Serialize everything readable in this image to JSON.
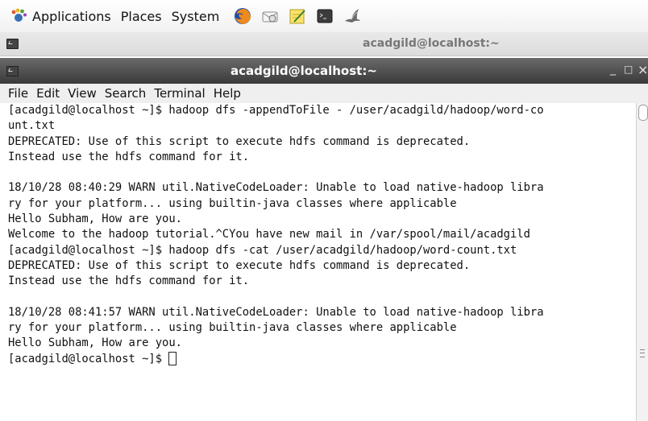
{
  "panel": {
    "menus": [
      "Applications",
      "Places",
      "System"
    ],
    "launchers": [
      "firefox-icon",
      "mail-icon",
      "notes-icon",
      "terminal-icon",
      "wireshark-icon"
    ]
  },
  "background_window": {
    "title": "acadgild@localhost:~"
  },
  "window": {
    "title": "acadgild@localhost:~",
    "controls": {
      "minimize": "_",
      "maximize": "□",
      "close": "×"
    },
    "menu": [
      "File",
      "Edit",
      "View",
      "Search",
      "Terminal",
      "Help"
    ]
  },
  "terminal": {
    "lines": [
      "[acadgild@localhost ~]$ hadoop dfs -appendToFile - /user/acadgild/hadoop/word-co",
      "unt.txt",
      "DEPRECATED: Use of this script to execute hdfs command is deprecated.",
      "Instead use the hdfs command for it.",
      "",
      "18/10/28 08:40:29 WARN util.NativeCodeLoader: Unable to load native-hadoop libra",
      "ry for your platform... using builtin-java classes where applicable",
      "Hello Subham, How are you.",
      "Welcome to the hadoop tutorial.^CYou have new mail in /var/spool/mail/acadgild",
      "[acadgild@localhost ~]$ hadoop dfs -cat /user/acadgild/hadoop/word-count.txt",
      "DEPRECATED: Use of this script to execute hdfs command is deprecated.",
      "Instead use the hdfs command for it.",
      "",
      "18/10/28 08:41:57 WARN util.NativeCodeLoader: Unable to load native-hadoop libra",
      "ry for your platform... using builtin-java classes where applicable",
      "Hello Subham, How are you."
    ],
    "prompt": "[acadgild@localhost ~]$ "
  }
}
